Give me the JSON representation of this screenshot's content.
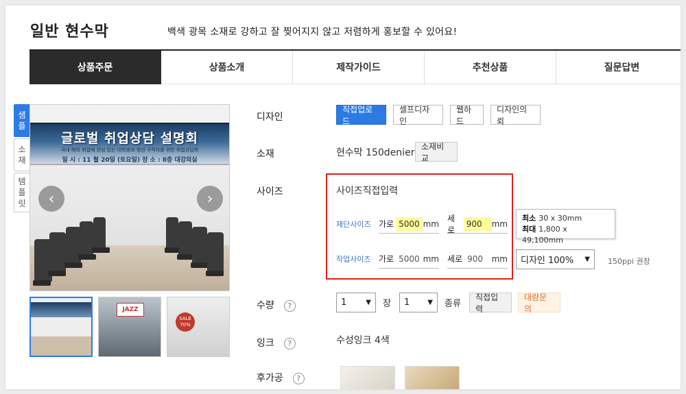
{
  "header": {
    "title": "일반 현수막",
    "subtitle": "백색 광목 소재로 강하고 잘 찢어지지 않고 저렴하게 홍보할 수 있어요!"
  },
  "tabs": [
    {
      "label": "상품주문",
      "active": true
    },
    {
      "label": "상품소개",
      "active": false
    },
    {
      "label": "제작가이드",
      "active": false
    },
    {
      "label": "추천상품",
      "active": false
    },
    {
      "label": "질문답변",
      "active": false
    }
  ],
  "side_tabs": [
    {
      "label": "샘플",
      "chars": [
        "샘",
        "플"
      ],
      "active": true
    },
    {
      "label": "소재",
      "chars": [
        "소",
        "재"
      ],
      "active": false
    },
    {
      "label": "템플릿",
      "chars": [
        "템",
        "플",
        "릿"
      ],
      "active": false
    }
  ],
  "preview": {
    "banner_title": "글로벌 취업상담 설명회",
    "banner_sub": "국내 해외 취업에 관심 있는 대학생과 청년 구직자를 위한 취업상담회",
    "banner_date": "일 시 : 11 월 20일 (토요일)   장 소 : 8층 대강의실",
    "prev_icon": "chevron-left-icon",
    "next_icon": "chevron-right-icon",
    "thumb2_text": "JAZZ",
    "thumb3_text": "SALE 70%"
  },
  "options": {
    "design": {
      "label": "디자인",
      "buttons": [
        "직접업로드",
        "셀프디자인",
        "웹하드",
        "디자인의뢰"
      ],
      "selected": "직접업로드"
    },
    "material": {
      "label": "소재",
      "value": "현수막 150denier",
      "compare_button": "소재비교"
    },
    "size": {
      "label": "사이즈",
      "mode": "사이즈직접입력",
      "cut": {
        "label": "재단사이즈",
        "width_label": "가로",
        "width": "5000",
        "height_label": "세로",
        "height": "900",
        "unit": "mm"
      },
      "work": {
        "label": "작업사이즈",
        "width_label": "가로",
        "width": "5000",
        "height_label": "세로",
        "height": "900",
        "unit": "mm"
      },
      "tooltip": {
        "min_label": "최소",
        "min_value": "30 x 30mm",
        "max_label": "최대",
        "max_value": "1,800 x 49,100mm"
      },
      "design_scale": "디자인 100%",
      "ppi_note": "150ppi 권장"
    },
    "quantity": {
      "label": "수량",
      "help": "?",
      "count": "1",
      "count_unit": "장",
      "kinds": "1",
      "kinds_unit": "종류",
      "direct_button": "직접입력",
      "bulk_button": "대량문의"
    },
    "ink": {
      "label": "잉크",
      "help": "?",
      "value": "수성잉크 4색"
    },
    "postprocess": {
      "label": "후가공",
      "help": "?"
    }
  },
  "colors": {
    "accent": "#2c7be5",
    "highlight_box": "#e0201a",
    "tab_active": "#2b2b2b",
    "field_highlight": "#fdfd9a"
  }
}
